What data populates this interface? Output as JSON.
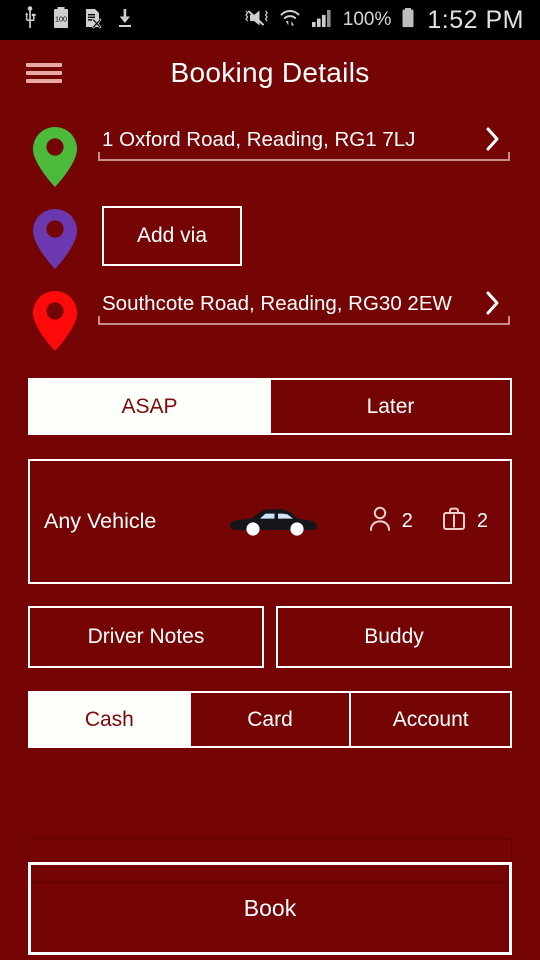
{
  "status_bar": {
    "left_icons": [
      "usb-icon",
      "battery-100-icon",
      "sim-card-error-icon",
      "download-icon"
    ],
    "battery_label": "100",
    "right_icons": [
      "mute-vibrate-icon",
      "wifi-transfer-icon",
      "signal-bars-icon"
    ],
    "battery_percent": "100%",
    "time": "1:52 PM"
  },
  "appbar": {
    "menu_icon": "hamburger-menu-icon",
    "title": "Booking Details"
  },
  "colors": {
    "background": "#750505",
    "accent_text": "#7a0b0b",
    "pickup_pin": "#4CBB3C",
    "via_pin": "#6B38B0",
    "dropoff_pin": "#FF0A0A",
    "border": "#ffffff"
  },
  "addresses": {
    "pickup": {
      "pin": "pickup-pin-icon",
      "text": "1 Oxford Road, Reading, RG1 7LJ",
      "chevron": "chevron-right-icon"
    },
    "via": {
      "pin": "via-pin-icon",
      "button_label": "Add via"
    },
    "dropoff": {
      "pin": "dropoff-pin-icon",
      "text": "Southcote Road, Reading, RG30 2EW",
      "chevron": "chevron-right-icon"
    }
  },
  "time_segment": {
    "options": [
      {
        "label": "ASAP",
        "selected": true
      },
      {
        "label": "Later",
        "selected": false
      }
    ]
  },
  "vehicle": {
    "name": "Any Vehicle",
    "car_icon": "sedan-car-icon",
    "passenger_icon": "passenger-icon",
    "passenger_count": "2",
    "luggage_icon": "luggage-icon",
    "luggage_count": "2"
  },
  "extras": {
    "driver_notes_label": "Driver Notes",
    "buddy_label": "Buddy"
  },
  "payment_segment": {
    "options": [
      {
        "label": "Cash",
        "selected": true
      },
      {
        "label": "Card",
        "selected": false
      },
      {
        "label": "Account",
        "selected": false
      }
    ]
  },
  "footer": {
    "book_label": "Book"
  }
}
